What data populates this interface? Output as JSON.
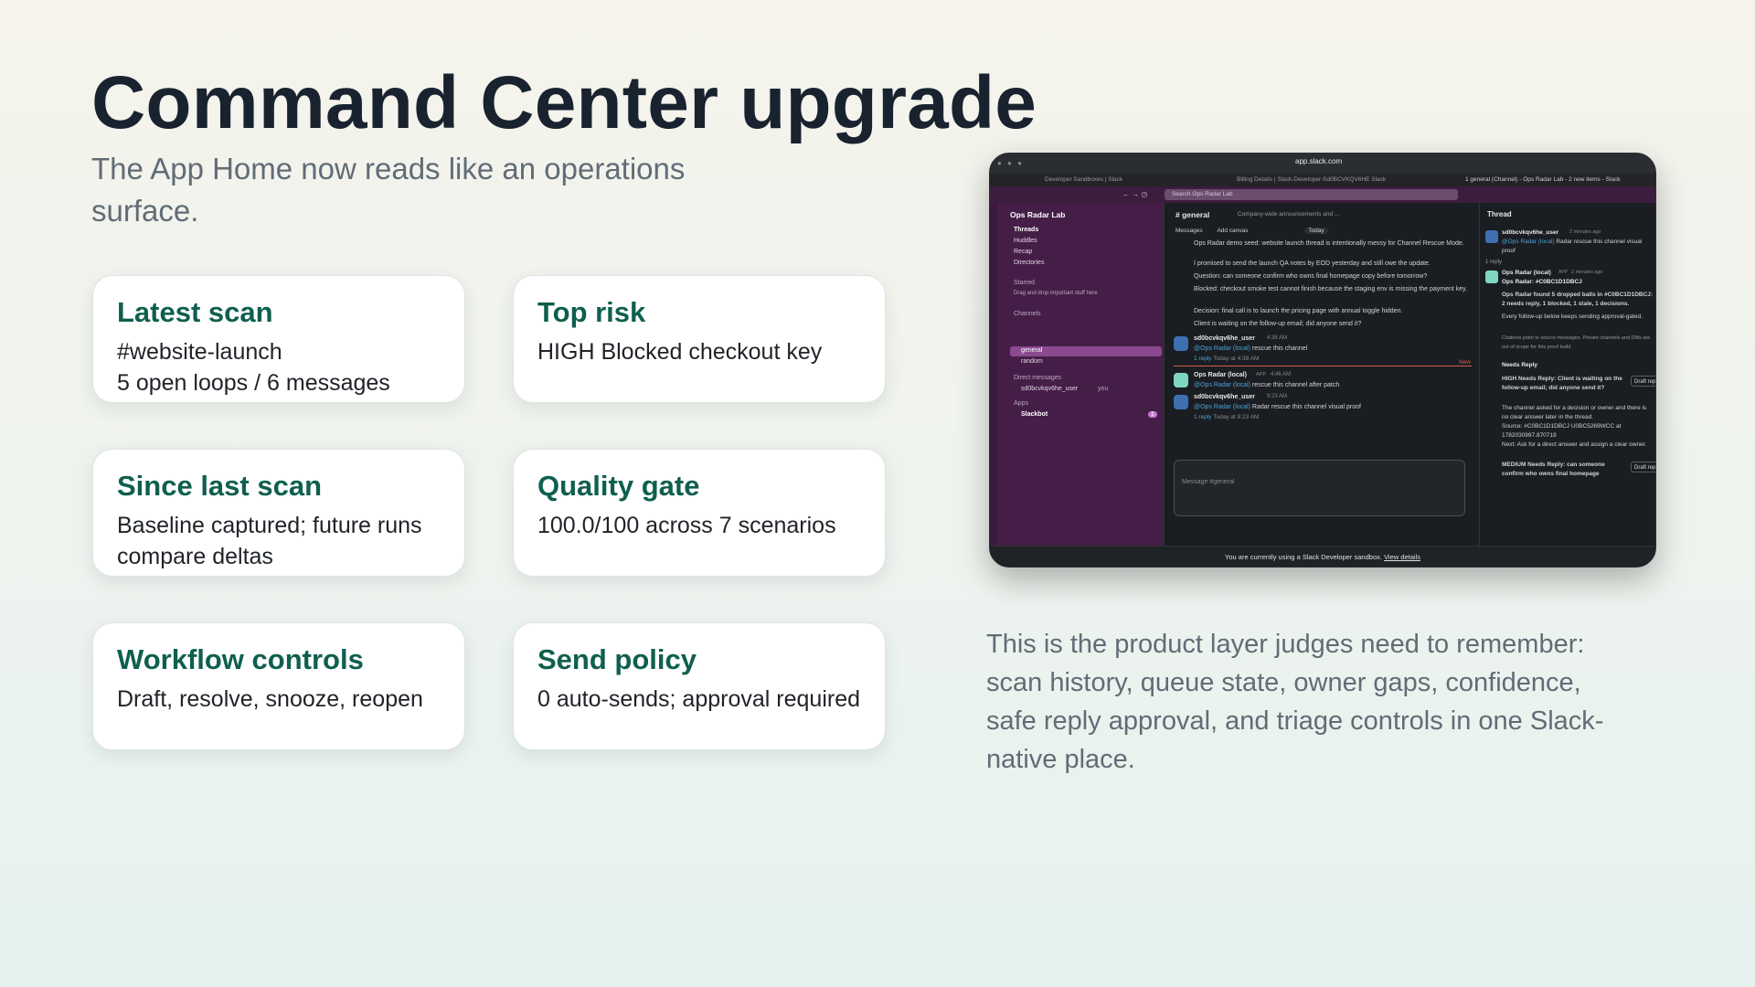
{
  "title": "Command Center upgrade",
  "subtitle": "The App Home now reads like an operations surface.",
  "cards": [
    {
      "title": "Latest scan",
      "body": "#website-launch\n5 open loops / 6 messages"
    },
    {
      "title": "Top risk",
      "body": "HIGH Blocked checkout key"
    },
    {
      "title": "Since last scan",
      "body": "Baseline captured; future runs compare deltas"
    },
    {
      "title": "Quality gate",
      "body": "100.0/100 across 7 scenarios"
    },
    {
      "title": "Workflow controls",
      "body": "Draft, resolve, snooze, reopen"
    },
    {
      "title": "Send policy",
      "body": "0 auto-sends; approval required"
    }
  ],
  "description": "This is the product layer judges need to remember: scan history, queue state, owner gaps, confidence, safe reply approval, and triage controls in one Slack-native place.",
  "screenshot": {
    "url": "app.slack.com",
    "tabs": [
      "Developer Sandboxes | Slack",
      "Billing Details | Slack-Developer-Sd0BCVKQV6HE Slack",
      "1 general (Channel) - Ops Radar Lab - 2 new items - Slack"
    ],
    "search_placeholder": "Search Ops Radar Lab",
    "workspace": "Ops Radar Lab",
    "sidebar": {
      "nav": [
        "Threads",
        "Huddles",
        "Recap",
        "Directories"
      ],
      "starred_header": "Starred",
      "starred_hint": "Drag and drop important stuff here",
      "channels_header": "Channels",
      "channels": [
        "general",
        "random"
      ],
      "dm_header": "Direct messages",
      "dm_user": "sd0bcvkqv6he_user",
      "dm_you": "you",
      "apps_header": "Apps",
      "app": "Slackbot",
      "app_badge": "1"
    },
    "channel": {
      "name": "# general",
      "description": "Company-wide announcements and ...",
      "member_count": "2",
      "tabs": [
        "Messages",
        "Add canvas"
      ],
      "date_pill": "Today",
      "messages": [
        "Ops Radar demo seed: website launch thread is intentionally messy for Channel Rescue Mode.",
        "I promised to send the launch QA notes by EOD yesterday and still owe the update.",
        "Question: can someone confirm who owns final homepage copy before tomorrow?",
        "Blocked: checkout smoke test cannot finish because the staging env is missing the payment key.",
        "Decision: final call is to launch the pricing page with annual toggle hidden.",
        "Client is waiting on the follow-up email; did anyone send it?"
      ],
      "posts": [
        {
          "user": "sd0bcvkqv6he_user",
          "time": "4:38 AM",
          "mention": "@Ops Radar (local)",
          "text": "rescue this channel",
          "reply": "1 reply",
          "reply_time": "Today at 4:38 AM"
        },
        {
          "user": "Ops Radar (local)",
          "app": "APP",
          "time": "4:46 AM",
          "mention": "@Ops Radar (local)",
          "text": "rescue this channel after patch"
        },
        {
          "user": "sd0bcvkqv6he_user",
          "time": "9:23 AM",
          "mention": "@Ops Radar (local)",
          "text": "Radar rescue this channel visual proof",
          "reply": "1 reply",
          "reply_time": "Today at 9:23 AM"
        }
      ],
      "new_label": "New",
      "composer_placeholder": "Message #general"
    },
    "thread": {
      "title": "Thread",
      "root_user": "sd0bcvkqv6he_user",
      "root_time": "2 minutes ago",
      "root_mention": "@Ops Radar (local)",
      "root_text": "Radar rescue this channel visual proof",
      "reply_count": "1 reply",
      "bot_user": "Ops Radar (local)",
      "bot_app": "APP",
      "bot_time": "2 minutes ago",
      "bot_heading": "Ops Radar: #C0BC1D1DBCJ",
      "bot_summary": "Ops Radar found 5 dropped balls in #C0BC1D1DBCJ: 2 needs reply, 1 blocked, 1 stale, 1 decisions.",
      "bot_followup": "Every follow-up below keeps sending approval-gated.",
      "bot_note": "Citations point to source messages. Private channels and DMs are out of scope for this proof build.",
      "needs_reply_header": "Needs Reply",
      "item1": "HIGH Needs Reply: Client is waiting on the follow-up email; did anyone send it?",
      "item1_detail": "The channel asked for a decision or owner and there is no clear answer later in the thread.",
      "item1_source": "Source: #C0BC1D1DBCJ U0BC5269WCC at 1782030997.870719",
      "item1_next": "Next: Ask for a direct answer and assign a clear owner.",
      "item2": "MEDIUM Needs Reply: can someone confirm who owns final homepage",
      "draft_label": "Draft reply"
    },
    "banner_text": "You are currently using a Slack Developer sandbox.",
    "banner_link": "View details"
  }
}
